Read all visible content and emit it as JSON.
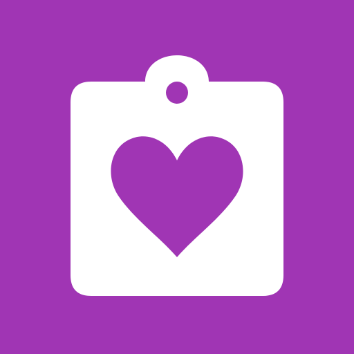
{
  "icon": {
    "name": "clipboard-heart-icon",
    "background_color": "#A035B4",
    "board_color": "#FFFFFF",
    "heart_color": "#A035B4"
  }
}
